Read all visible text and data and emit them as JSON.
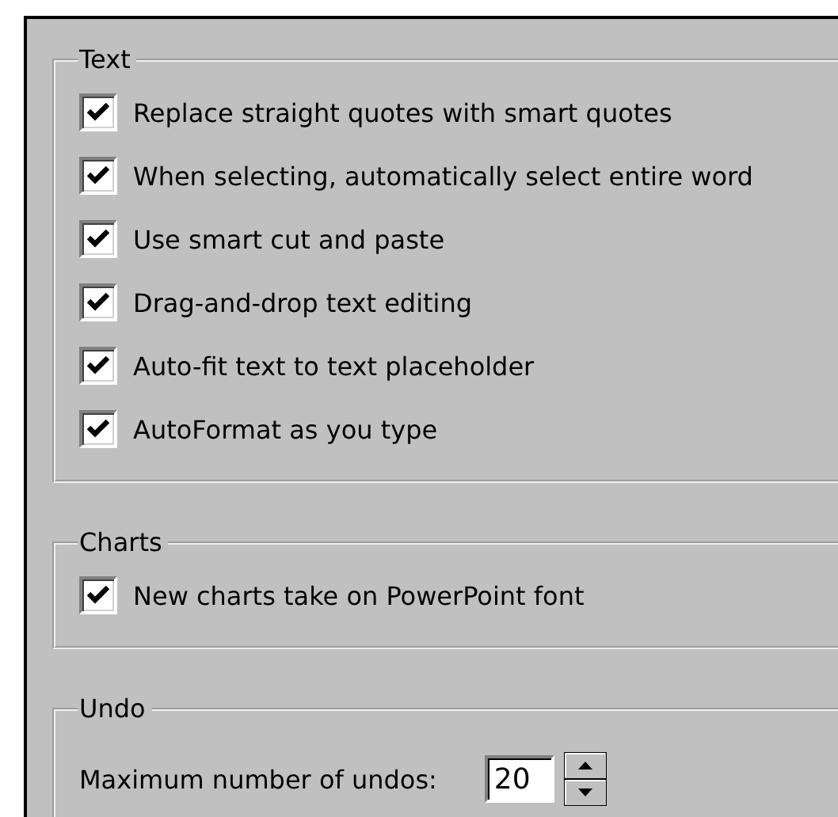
{
  "groups": [
    {
      "title": "Text",
      "options": [
        {
          "label": "Replace straight quotes with smart quotes",
          "checked": true
        },
        {
          "label": "When selecting, automatically select entire word",
          "checked": true
        },
        {
          "label": "Use smart cut and paste",
          "checked": true
        },
        {
          "label": "Drag-and-drop text editing",
          "checked": true
        },
        {
          "label": "Auto-fit text to text placeholder",
          "checked": true
        },
        {
          "label": "AutoFormat as you type",
          "checked": true
        }
      ]
    },
    {
      "title": "Charts",
      "options": [
        {
          "label": "New charts take on PowerPoint font",
          "checked": true
        }
      ]
    },
    {
      "title": "Undo",
      "spinner": {
        "label": "Maximum number of undos:",
        "value": "20"
      }
    }
  ]
}
